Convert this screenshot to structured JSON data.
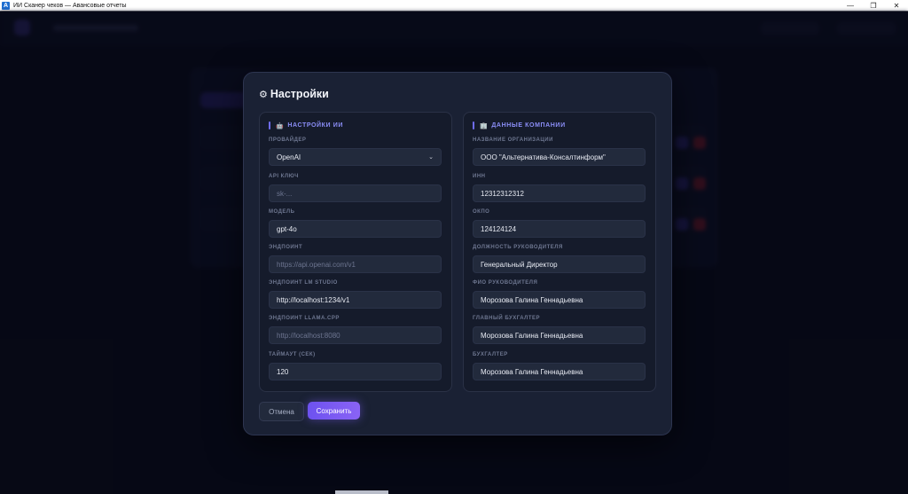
{
  "window": {
    "title": "ИИ Сканер чеков — Авансовые отчеты",
    "app_icon_letter": "A"
  },
  "modal": {
    "title": "Настройки",
    "ai_section": {
      "heading": "НАСТРОЙКИ ИИ",
      "provider": {
        "label": "ПРОВАЙДЕР",
        "value": "OpenAI"
      },
      "api_key": {
        "label": "API КЛЮЧ",
        "placeholder": "sk-..."
      },
      "model": {
        "label": "МОДЕЛЬ",
        "value": "gpt-4o"
      },
      "endpoint": {
        "label": "ЭНДПОИНТ",
        "placeholder": "https://api.openai.com/v1"
      },
      "lm_studio": {
        "label": "ЭНДПОИНТ LM STUDIO",
        "value": "http://localhost:1234/v1"
      },
      "llama_cpp": {
        "label": "ЭНДПОИНТ LLAMA.CPP",
        "placeholder": "http://localhost:8080"
      },
      "timeout": {
        "label": "ТАЙМАУТ (СЕК)",
        "value": "120"
      }
    },
    "company_section": {
      "heading": "ДАННЫЕ КОМПАНИИ",
      "org_name": {
        "label": "НАЗВАНИЕ ОРГАНИЗАЦИИ",
        "value": "ООО \"Альтернатива-Консалтинформ\""
      },
      "inn": {
        "label": "ИНН",
        "value": "12312312312"
      },
      "okpo": {
        "label": "ОКПО",
        "value": "124124124"
      },
      "head_position": {
        "label": "ДОЛЖНОСТЬ РУКОВОДИТЕЛЯ",
        "value": "Генеральный Директор"
      },
      "head_name": {
        "label": "ФИО РУКОВОДИТЕЛЯ",
        "value": "Морозова Галина Геннадьевна"
      },
      "chief_accountant": {
        "label": "ГЛАВНЫЙ БУХГАЛТЕР",
        "value": "Морозова Галина Геннадьевна"
      },
      "accountant": {
        "label": "БУХГАЛТЕР",
        "value": "Морозова Галина Геннадьевна"
      }
    },
    "buttons": {
      "cancel": "Отмена",
      "save": "Сохранить"
    }
  },
  "colors": {
    "accent": "#8b8ef7",
    "save_gradient_start": "#6d52f0",
    "save_gradient_end": "#8a63f5",
    "panel_bg": "#151b2b",
    "modal_bg": "#1a2134"
  },
  "icons": {
    "gear": "gear-icon",
    "ai": "robot-icon",
    "company": "building-icon",
    "select": "chevron-down-icon"
  }
}
